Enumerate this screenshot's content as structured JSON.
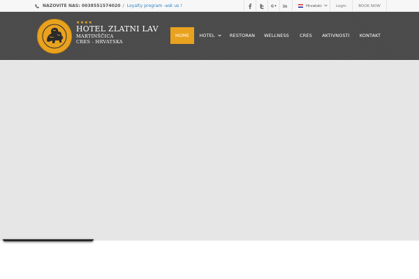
{
  "topbar": {
    "phone_label": "NAZOVITE NAS: 0038551574020",
    "separator": "/",
    "loyalty_link": "Loyalty program -ask us !",
    "social": [
      {
        "name": "facebook",
        "glyph": "f"
      },
      {
        "name": "twitter",
        "glyph": "t"
      },
      {
        "name": "google-plus",
        "glyph": "G"
      },
      {
        "name": "linkedin",
        "glyph": "in"
      }
    ],
    "language": "Hrvatski",
    "login": "Login",
    "book_now": "BOOK NOW"
  },
  "header": {
    "stars": "★★★★",
    "hotel_name": "HOTEL ZLATNI LAV",
    "location_line1": "MARTINŠČICA",
    "location_line2": "CRES - HRVATSKA",
    "nav": [
      {
        "label": "HOME",
        "active": true
      },
      {
        "label": "HOTEL",
        "has_dropdown": true
      },
      {
        "label": "RESTORAN"
      },
      {
        "label": "WELLNESS"
      },
      {
        "label": "CRES"
      },
      {
        "label": "AKTIVNOSTI"
      },
      {
        "label": "KONTAKT"
      }
    ]
  },
  "colors": {
    "accent": "#e9a21f",
    "header_bg": "#4a4a4a",
    "hero_bg": "#e6e6e6",
    "link": "#2a7fc1"
  }
}
